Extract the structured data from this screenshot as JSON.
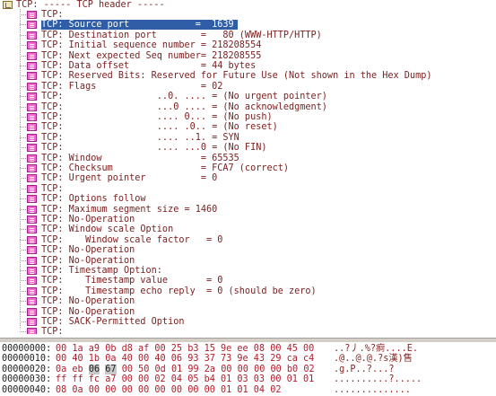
{
  "tree": {
    "root_label": "TCP: ----- TCP header -----",
    "items": [
      {
        "text": "TCP:",
        "selected": false
      },
      {
        "text": "TCP: Source port            =  1639",
        "selected": true
      },
      {
        "text": "TCP: Destination port        =   80 (WWW-HTTP/HTTP)",
        "selected": false
      },
      {
        "text": "TCP: Initial sequence number = 218208554",
        "selected": false
      },
      {
        "text": "TCP: Next expected Seq number= 218208555",
        "selected": false
      },
      {
        "text": "TCP: Data offset             = 44 bytes",
        "selected": false
      },
      {
        "text": "TCP: Reserved Bits: Reserved for Future Use (Not shown in the Hex Dump)",
        "selected": false
      },
      {
        "text": "TCP: Flags                   = 02",
        "selected": false
      },
      {
        "text": "TCP:                 ..0. .... = (No urgent pointer)",
        "selected": false
      },
      {
        "text": "TCP:                 ...0 .... = (No acknowledgment)",
        "selected": false
      },
      {
        "text": "TCP:                 .... 0... = (No push)",
        "selected": false
      },
      {
        "text": "TCP:                 .... .0.. = (No reset)",
        "selected": false
      },
      {
        "text": "TCP:                 .... ..1. = SYN",
        "selected": false
      },
      {
        "text": "TCP:                 .... ...0 = (No FIN)",
        "selected": false
      },
      {
        "text": "TCP: Window                  = 65535",
        "selected": false
      },
      {
        "text": "TCP: Checksum                = FCA7 (correct)",
        "selected": false
      },
      {
        "text": "TCP: Urgent pointer          = 0",
        "selected": false
      },
      {
        "text": "TCP:",
        "selected": false
      },
      {
        "text": "TCP: Options follow",
        "selected": false
      },
      {
        "text": "TCP: Maximum segment size = 1460",
        "selected": false
      },
      {
        "text": "TCP: No-Operation",
        "selected": false
      },
      {
        "text": "TCP: Window scale Option",
        "selected": false
      },
      {
        "text": "TCP:    Window scale factor   = 0",
        "selected": false
      },
      {
        "text": "TCP: No-Operation",
        "selected": false
      },
      {
        "text": "TCP: No-Operation",
        "selected": false
      },
      {
        "text": "TCP: Timestamp Option:",
        "selected": false
      },
      {
        "text": "TCP:    Timestamp value       = 0",
        "selected": false
      },
      {
        "text": "TCP:    Timestamp echo reply  = 0 (should be zero)",
        "selected": false
      },
      {
        "text": "TCP: No-Operation",
        "selected": false
      },
      {
        "text": "TCP: No-Operation",
        "selected": false
      },
      {
        "text": "TCP: SACK-Permitted Option",
        "selected": false
      },
      {
        "text": "TCP:",
        "selected": false
      }
    ]
  },
  "hex": {
    "rows": [
      {
        "offset": "00000000:",
        "bytes": "00 1a a9 0b d8 af 00 25 b3 15 9e ee 08 00 45 00",
        "ascii": "..?丿.%?痾....E."
      },
      {
        "offset": "00000010:",
        "bytes": "00 40 1b 0a 40 00 40 06 93 37 73 9e 43 29 ca c4",
        "ascii": ".@..@.@.?s漢)售"
      },
      {
        "offset": "00000020:",
        "bytes": "0a eb 06 67 00 50 0d 01 99 2a 00 00 00 00 b0 02",
        "ascii": ".g.P..?...?",
        "highlight_start": 2,
        "highlight_end": 3
      },
      {
        "offset": "00000030:",
        "bytes": "ff ff fc a7 00 00 02 04 05 b4 01 03 03 00 01 01",
        "ascii": "..........?....."
      },
      {
        "offset": "00000040:",
        "bytes": "08 0a 00 00 00 00 00 00 00 00 01 01 04 02",
        "ascii": ".............."
      }
    ]
  }
}
